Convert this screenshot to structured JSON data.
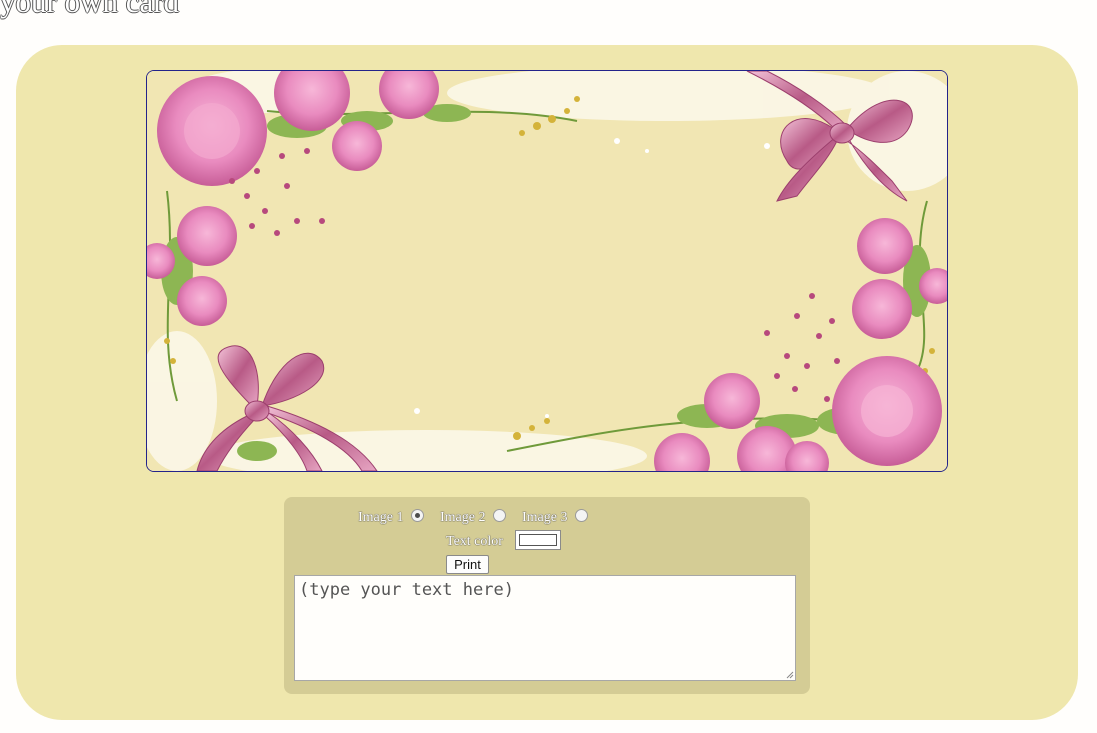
{
  "page": {
    "title": "your own card"
  },
  "card": {
    "selected_image": "Image 1"
  },
  "controls": {
    "images": [
      {
        "label": "Image 1",
        "checked": true
      },
      {
        "label": "Image 2",
        "checked": false
      },
      {
        "label": "Image 3",
        "checked": false
      }
    ],
    "text_color_label": "Text color",
    "text_color_value": "#ffffff",
    "print_label": "Print",
    "textarea": {
      "value": "(type your text here)"
    }
  },
  "colors": {
    "panel": "#efe7ad",
    "controls_panel": "#d4cc95",
    "card_border": "#23238a"
  }
}
